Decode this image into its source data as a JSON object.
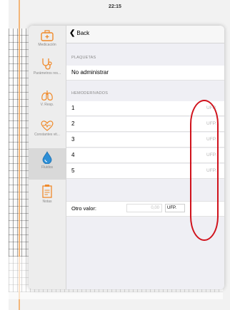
{
  "status_bar": {
    "time": "22:15"
  },
  "nav": {
    "back_label": "Back"
  },
  "sidebar": {
    "items": [
      {
        "label": "Medicación",
        "icon": "briefcase-icon"
      },
      {
        "label": "Parámetros res...",
        "icon": "stethoscope-icon"
      },
      {
        "label": "V. Resp.",
        "icon": "lungs-icon"
      },
      {
        "label": "Constantes vit...",
        "icon": "heart-monitor-icon"
      },
      {
        "label": "Fluidos",
        "icon": "drop-icon"
      },
      {
        "label": "Notas",
        "icon": "notepad-icon"
      }
    ],
    "active_index": 4
  },
  "plaquetas": {
    "header": "PLAQUETAS",
    "value": "No administrar"
  },
  "hemoderivados": {
    "header": "HEMODERIVADOS",
    "rows": [
      {
        "label": "1",
        "unit": "UFP."
      },
      {
        "label": "2",
        "unit": "UFP."
      },
      {
        "label": "3",
        "unit": "UFP."
      },
      {
        "label": "4",
        "unit": "UFP."
      },
      {
        "label": "5",
        "unit": "UFP."
      }
    ]
  },
  "otro_valor": {
    "label": "Otro valor:",
    "value": "0,00",
    "unit": "UFP."
  },
  "colors": {
    "annotation": "#d0121c",
    "accent": "#f2a65a"
  }
}
